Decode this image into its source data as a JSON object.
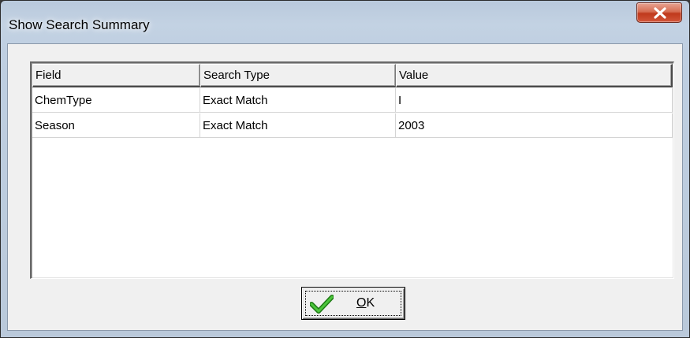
{
  "window": {
    "title": "Show Search Summary",
    "close_icon": "close-x-icon"
  },
  "grid": {
    "columns": [
      "Field",
      "Search Type",
      "Value"
    ],
    "rows": [
      [
        "ChemType",
        "Exact Match",
        "I"
      ],
      [
        "Season",
        "Exact Match",
        "2003"
      ]
    ]
  },
  "ok_button": {
    "mnemonic": "O",
    "label_rest": "K",
    "icon": "checkmark-icon",
    "icon_color": "#2aa31f"
  },
  "colors": {
    "close_button": "#c7452a",
    "titlebar": "#c3d2e3",
    "client": "#f0f0f0"
  }
}
